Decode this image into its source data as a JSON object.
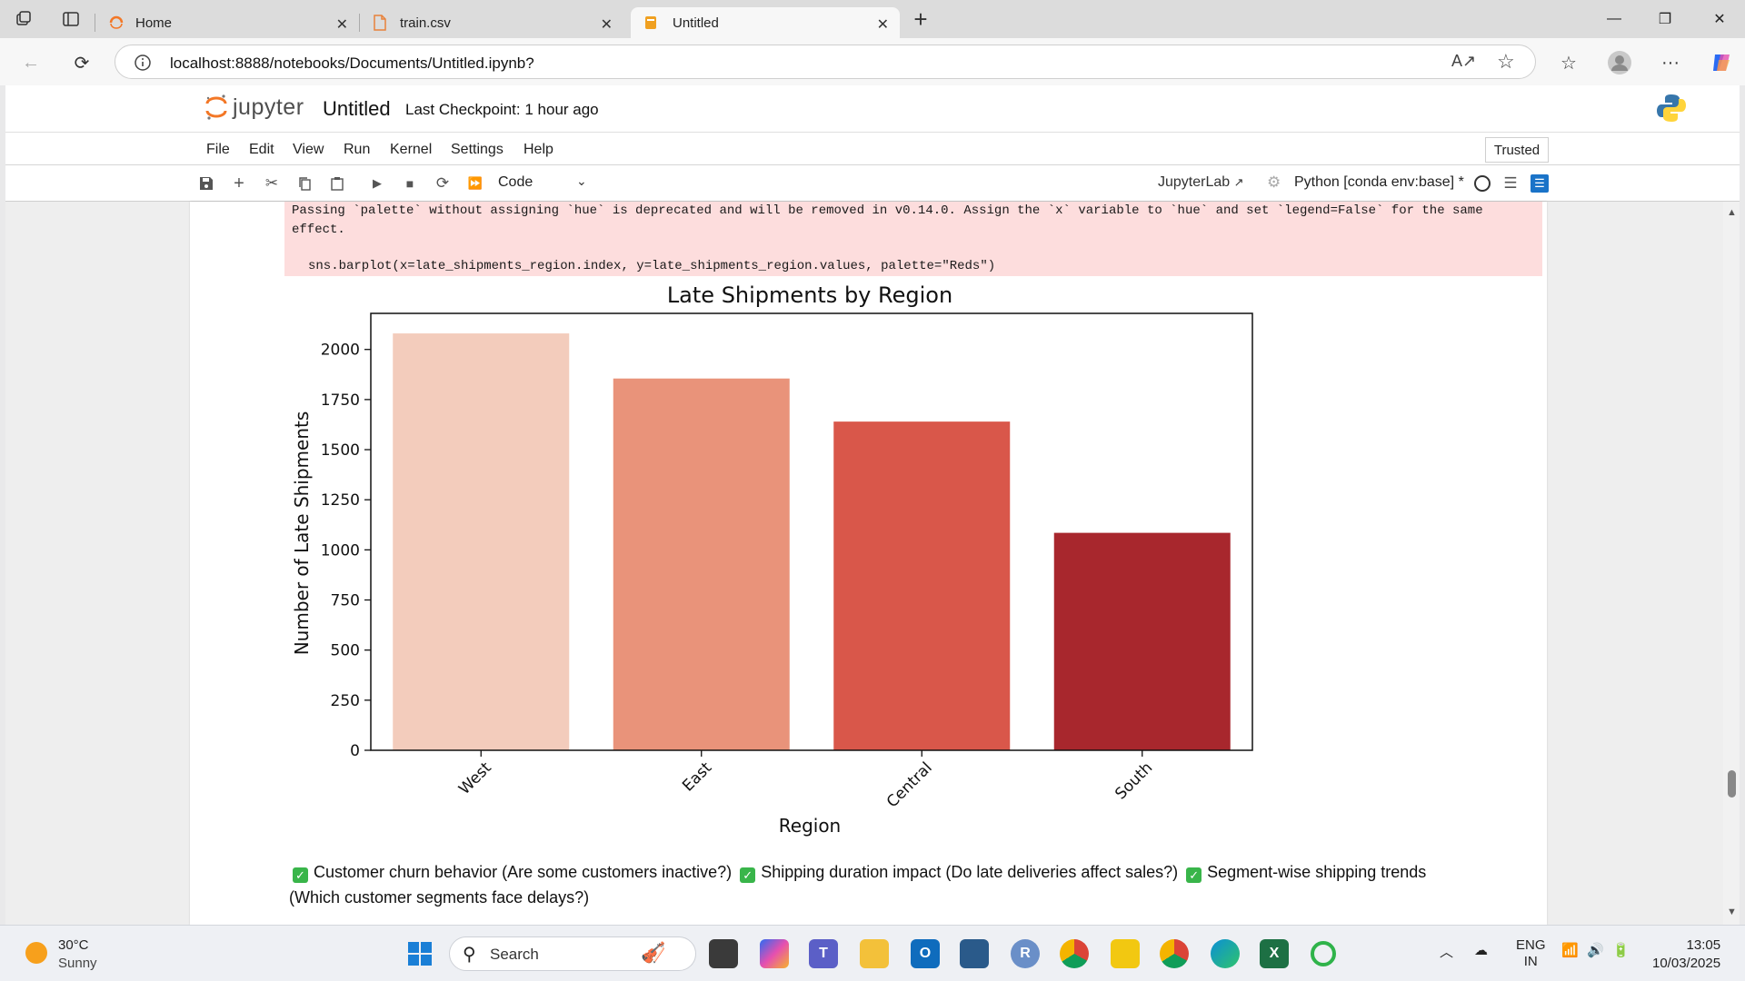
{
  "browser": {
    "tabs": [
      {
        "label": "Home",
        "icon": "jupyter-icon"
      },
      {
        "label": "train.csv",
        "icon": "file-icon"
      },
      {
        "label": "Untitled",
        "icon": "notebook-icon",
        "active": true
      }
    ],
    "url": "localhost:8888/notebooks/Documents/Untitled.ipynb?"
  },
  "jupyter": {
    "logo_text": "jupyter",
    "notebook_title": "Untitled",
    "checkpoint": "Last Checkpoint: 1 hour ago",
    "menu": [
      "File",
      "Edit",
      "View",
      "Run",
      "Kernel",
      "Settings",
      "Help"
    ],
    "trusted": "Trusted",
    "cell_type": "Code",
    "jupyterlab_link": "JupyterLab",
    "kernel": "Python [conda env:base] *"
  },
  "output": {
    "warning_line": "Passing `palette` without assigning `hue` is deprecated and will be removed in v0.14.0. Assign the `x` variable to `hue` and set `legend=False` for the same effect.",
    "code_line": "sns.barplot(x=late_shipments_region.index, y=late_shipments_region.values, palette=\"Reds\")"
  },
  "chart_data": {
    "type": "bar",
    "title": "Late Shipments by Region",
    "xlabel": "Region",
    "ylabel": "Number of Late Shipments",
    "categories": [
      "West",
      "East",
      "Central",
      "South"
    ],
    "values": [
      2080,
      1855,
      1640,
      1085
    ],
    "ylim": [
      0,
      2180
    ],
    "yticks": [
      0,
      250,
      500,
      750,
      1000,
      1250,
      1500,
      1750,
      2000
    ],
    "colors": [
      "#f3ccbc",
      "#e9937a",
      "#d9574a",
      "#a8272d"
    ],
    "grid": false
  },
  "markdown": {
    "items": [
      "Customer churn behavior (Are some customers inactive?)",
      "Shipping duration impact (Do late deliveries affect sales?)",
      "Segment-wise shipping trends (Which customer segments face delays?)"
    ]
  },
  "taskbar": {
    "temperature": "30°C",
    "condition": "Sunny",
    "search_placeholder": "Search",
    "lang_top": "ENG",
    "lang_bottom": "IN",
    "time": "13:05",
    "date": "10/03/2025"
  }
}
